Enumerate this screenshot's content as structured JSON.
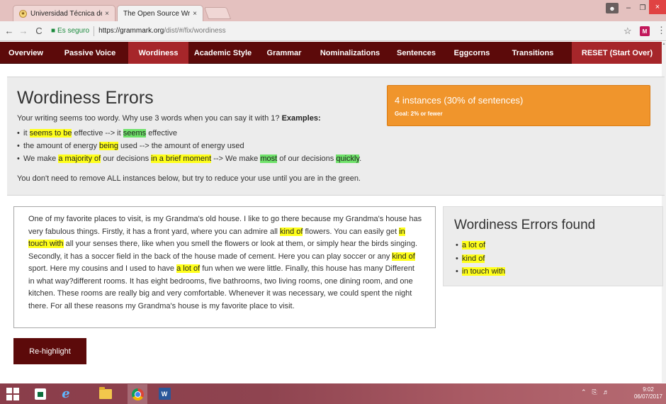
{
  "browser": {
    "tabs": [
      {
        "label": "Universidad Técnica de A",
        "close": "×"
      },
      {
        "label": "The Open Source Writing",
        "close": "×"
      }
    ],
    "window": {
      "user_icon": "user-icon",
      "minimize": "–",
      "maximize": "❐",
      "close": "×"
    },
    "nav": {
      "back": "←",
      "forward": "→",
      "reload": "C"
    },
    "address": {
      "secure_label": "Es seguro",
      "url_host": "https://grammark.org",
      "url_path": "/dist/#/fix/wordiness"
    },
    "star": "☆",
    "extension_label": "M",
    "menu": "⋮"
  },
  "app_nav": {
    "items": [
      "Overview",
      "Passive Voice",
      "Wordiness",
      "Academic Style",
      "Grammar",
      "Nominalizations",
      "Sentences",
      "Eggcorns",
      "Transitions"
    ],
    "active": "Wordiness",
    "reset_label": "RESET (Start Over)"
  },
  "header": {
    "title": "Wordiness Errors",
    "intro": "Your writing seems too wordy. Why use 3 words when you can say it with 1?",
    "examples_label": "Examples:",
    "ex1": {
      "a": "it ",
      "b": "seems to be",
      "c": " effective --> it ",
      "d": "seems",
      "e": " effective"
    },
    "ex2": {
      "a": "the amount of energy ",
      "b": "being",
      "c": " used --> the amount of energy used"
    },
    "ex3": {
      "a": "We make ",
      "b": "a majority of",
      "c": " our decisions ",
      "d": "in a brief moment",
      "e": " --> We make ",
      "f": "most",
      "g": " of our decisions ",
      "h": "quickly",
      "i": "."
    },
    "note": "You don't need to remove ALL instances below, but try to reduce your use until you are in the green."
  },
  "stats": {
    "main": "4 instances (30% of sentences)",
    "goal": "Goal: 2% or fewer",
    "color": "#f0952c"
  },
  "essay": {
    "p1": "One of my favorite places to visit, is my Grandma's old house. I like to go there because my Grandma's house has very fabulous things. Firstly, it has a front yard, where you can admire all ",
    "h1": "kind of",
    "p2": " flowers. You can easily get ",
    "h2": "in touch with",
    "p3": " all your senses there, like when you smell the flowers or look at them, or simply hear the birds singing. Secondly, it has a soccer field in the back of the house made of cement. Here you can play soccer or any ",
    "h3": "kind of",
    "p4": " sport. Here my cousins and I used to have ",
    "h4": "a lot of",
    "p5": " fun when we were little. Finally, this house has many Different in what way?different rooms. It has eight bedrooms, five bathrooms, two living rooms, one dining room, and one kitchen. These rooms are really big and very comfortable. Whenever it was necessary, we could spent the night there. For all these reasons my Grandma's house is my favorite place to visit."
  },
  "found": {
    "title": "Wordiness Errors found",
    "items": [
      "a lot of",
      "kind of",
      "in touch with"
    ]
  },
  "actions": {
    "rehighlight_label": "Re-highlight"
  },
  "taskbar": {
    "word_label": "W",
    "clock_time": "9:02",
    "clock_date": "06/07/2017"
  },
  "colors": {
    "nav_bg": "#5c0a0a",
    "nav_active": "#a6262a",
    "highlight_yellow": "#ffff1a",
    "highlight_green": "#6fe26a"
  }
}
